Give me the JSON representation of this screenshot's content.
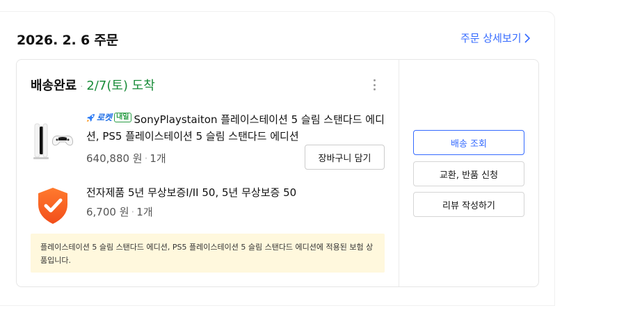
{
  "order": {
    "date_title": "2026. 2. 6 주문",
    "detail_link": "주문 상세보기"
  },
  "delivery": {
    "status": "배송완료",
    "arrival": "2/7(토) 도착"
  },
  "items": [
    {
      "badge_rocket": "로켓",
      "badge_tomorrow": "내일",
      "title": "SonyPlaystaiton 플레이스테이션 5 슬림 스탠다드 에디션, PS5 플레이스테이션 5 슬림 스탠다드 에디션",
      "price": "640,880 원",
      "qty": "1개",
      "cart_button": "장바구니 담기"
    },
    {
      "title": "전자제품 5년 무상보증I/II 50, 5년 무상보증 50",
      "price": "6,700 원",
      "qty": "1개"
    }
  ],
  "notice": "플레이스테이션 5 슬림 스탠다드 에디션, PS5 플레이스테이션 5 슬림 스탠다드 에디션에 적용된 보험 상품입니다.",
  "actions": {
    "track": "배송 조회",
    "exchange": "교환, 반품 신청",
    "review": "리뷰 작성하기"
  },
  "colors": {
    "accent": "#346aff",
    "arrival_green": "#1a8c3a",
    "notice_bg": "#fff8dd",
    "shield_orange": "#f5591f"
  },
  "icons": {
    "more": "kebab-menu-icon",
    "chevron": "chevron-right-icon",
    "rocket": "rocket-icon",
    "insurance": "shield-check-icon"
  }
}
